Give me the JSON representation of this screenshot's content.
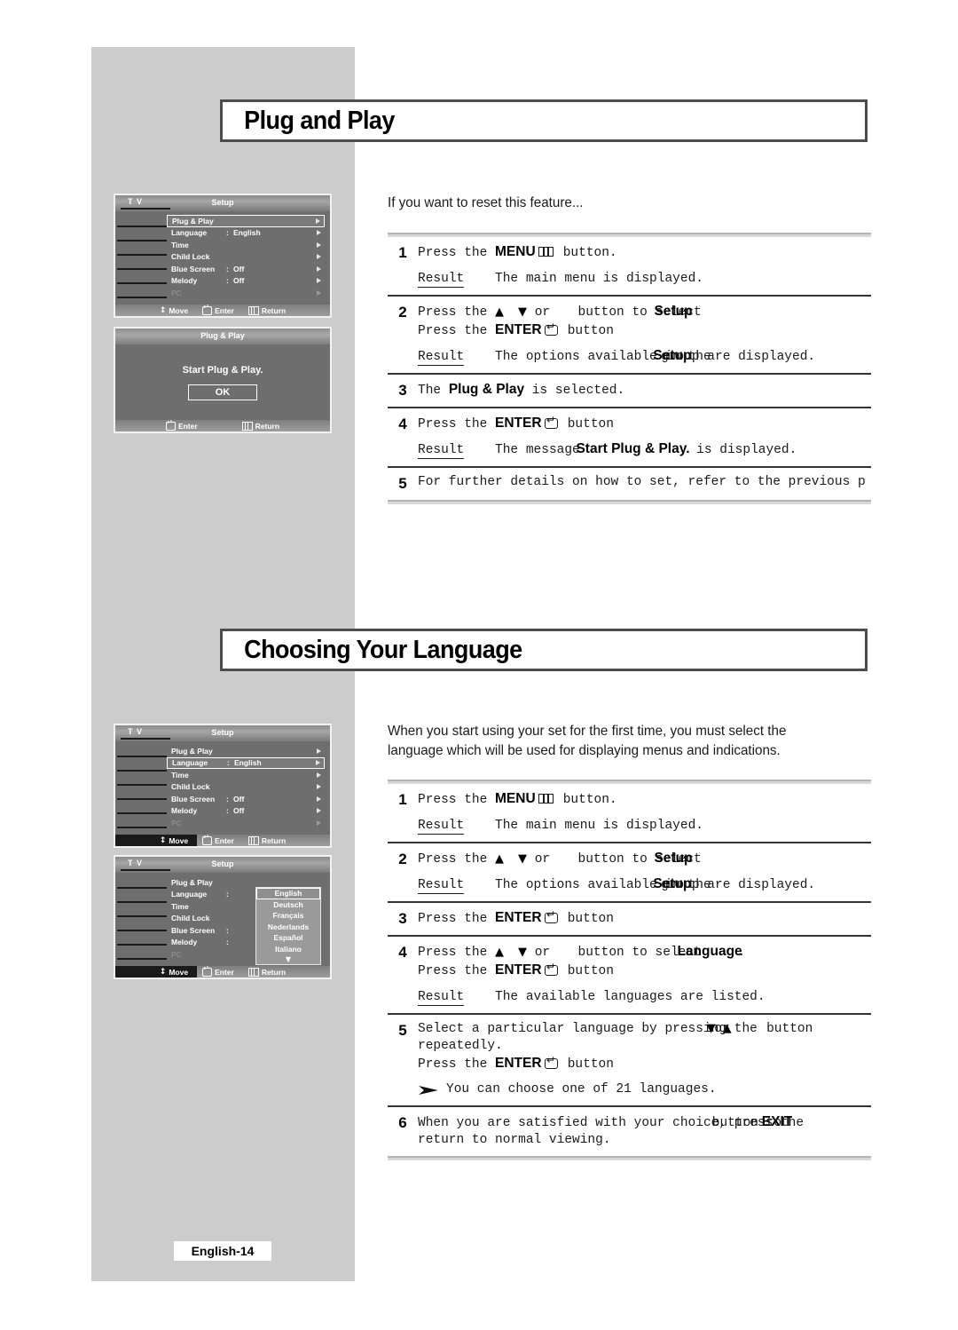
{
  "page": {
    "footer_tag": "English-14"
  },
  "sections": [
    {
      "title": "Plug and Play",
      "intro": "If you want to reset this feature...",
      "steps": [
        {
          "num": "1",
          "line1_pre": "Press the ",
          "line1_bold": "MENU",
          "line1_icon": "menu-icon",
          "line1_post": " button.",
          "result_label": "Result",
          "result_text": "The main menu is displayed."
        },
        {
          "num": "2",
          "line1_pre": "Press the ",
          "line1_up": "▲",
          "line1_mid": " or ",
          "line1_down": "▼",
          "line1_post": " button to select ",
          "line1_bold": "Setup",
          "line1_end": ".",
          "line2_pre": "Press the ",
          "line2_bold": "ENTER",
          "line2_icon": "enter-icon",
          "line2_post": " button",
          "result_label": "Result",
          "result_pre": "The options available in the ",
          "result_bold": "Setup",
          "result_post": " group are displayed."
        },
        {
          "num": "3",
          "line1_pre": "The ",
          "line1_bold": "Plug & Play",
          "line1_post": " is selected."
        },
        {
          "num": "4",
          "line1_pre": "Press the ",
          "line1_bold": "ENTER",
          "line1_icon": "enter-icon",
          "line1_post": " button",
          "result_label": "Result",
          "result_pre": "The message ",
          "result_bold": "Start Plug & Play.",
          "result_post": " is displayed."
        },
        {
          "num": "5",
          "line1_pre": "For further details on how to set, refer to the previous p"
        }
      ]
    },
    {
      "title": "Choosing Your Language",
      "intro": "When you start using your set for the first time, you must select the\nlanguage which will be used for displaying menus and indications.",
      "steps": [
        {
          "num": "1",
          "line1_pre": "Press the ",
          "line1_bold": "MENU",
          "line1_icon": "menu-icon",
          "line1_post": " button.",
          "result_label": "Result",
          "result_text": "The main menu is displayed."
        },
        {
          "num": "2",
          "line1_pre": "Press the ",
          "line1_up": "▲",
          "line1_mid": " or ",
          "line1_down": "▼",
          "line1_post": " button to select ",
          "line1_bold": "Setup",
          "line1_end": ".",
          "result_label": "Result",
          "result_pre": "The options available in the ",
          "result_bold": "Setup",
          "result_post": " group are displayed."
        },
        {
          "num": "3",
          "line1_pre": "Press the ",
          "line1_bold": "ENTER",
          "line1_icon": "enter-icon",
          "line1_post": " button"
        },
        {
          "num": "4",
          "line1_pre": "Press the ",
          "line1_up": "▲",
          "line1_mid": " or ",
          "line1_down": "▼",
          "line1_post": " button to select ",
          "line1_bold": "Language",
          "line1_end": ".",
          "line2_pre": "Press the ",
          "line2_bold": "ENTER",
          "line2_icon": "enter-icon",
          "line2_post": " button",
          "result_label": "Result",
          "result_pre": "The available languages are listed.",
          "result_bold": "",
          "result_post": ""
        },
        {
          "num": "5",
          "line1_pre": "Select a particular language by pressing the ",
          "line1_up": "▲",
          "line1_mid": " or ",
          "line1_down": "▼",
          "line1_post": " button",
          "line2": "repeatedly.",
          "line3_pre": "Press the ",
          "line3_bold": "ENTER",
          "line3_icon": "enter-icon",
          "line3_post": " button",
          "note_icon": "arrow-bullet-icon",
          "note_text": "You can choose one of 21 languages."
        },
        {
          "num": "6",
          "line1_pre": "When you are satisfied with your choice, press the ",
          "line1_bold": "EXIT",
          "line1_post": " button to",
          "line2": "return to normal viewing."
        }
      ]
    }
  ],
  "osd": {
    "tv_label": "T V",
    "setup_title": "Setup",
    "footer": {
      "move": "Move",
      "enter": "Enter",
      "return": "Return"
    },
    "menu_items": [
      {
        "label": "Plug & Play",
        "colon": "",
        "value": ""
      },
      {
        "label": "Language",
        "colon": ":",
        "value": "English"
      },
      {
        "label": "Time",
        "colon": "",
        "value": ""
      },
      {
        "label": "Child Lock",
        "colon": "",
        "value": ""
      },
      {
        "label": "Blue Screen",
        "colon": ":",
        "value": "Off"
      },
      {
        "label": "Melody",
        "colon": ":",
        "value": "Off"
      },
      {
        "label": "PC",
        "colon": "",
        "value": ""
      }
    ],
    "dialog": {
      "title": "Plug & Play",
      "message": "Start Plug & Play.",
      "ok": "OK",
      "enter": "Enter",
      "return": "Return"
    },
    "languages": [
      "English",
      "Deutsch",
      "Français",
      "Nederlands",
      "Español",
      "Italiano"
    ],
    "languages_more": "▼"
  }
}
